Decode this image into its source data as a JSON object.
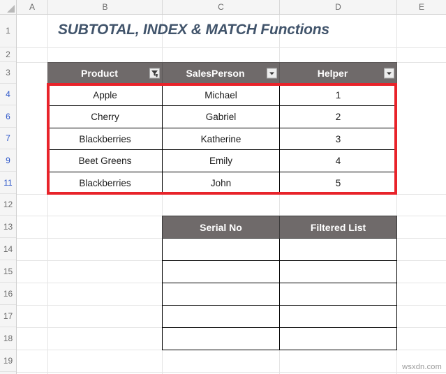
{
  "spreadsheet": {
    "title": "SUBTOTAL, INDEX & MATCH Functions",
    "watermark": "wsxdn.com",
    "column_headers": [
      "A",
      "B",
      "C",
      "D",
      "E"
    ],
    "row_headers": [
      {
        "label": "1",
        "filtered": false
      },
      {
        "label": "2",
        "filtered": false
      },
      {
        "label": "3",
        "filtered": false
      },
      {
        "label": "4",
        "filtered": true
      },
      {
        "label": "6",
        "filtered": true
      },
      {
        "label": "7",
        "filtered": true
      },
      {
        "label": "9",
        "filtered": true
      },
      {
        "label": "11",
        "filtered": true
      },
      {
        "label": "12",
        "filtered": false
      },
      {
        "label": "13",
        "filtered": false
      },
      {
        "label": "14",
        "filtered": false
      },
      {
        "label": "15",
        "filtered": false
      },
      {
        "label": "16",
        "filtered": false
      },
      {
        "label": "17",
        "filtered": false
      },
      {
        "label": "18",
        "filtered": false
      },
      {
        "label": "19",
        "filtered": false
      }
    ],
    "colors": {
      "header_fill": "#6f6a6a",
      "header_text": "#ffffff",
      "title_text": "#41546b",
      "highlight_border": "#e8232a",
      "filtered_row_header": "#2b55c9"
    }
  },
  "data_table": {
    "headers": [
      {
        "label": "Product",
        "filter_icon": "funnel-filter-applied-icon"
      },
      {
        "label": "SalesPerson",
        "filter_icon": "chevron-down-icon"
      },
      {
        "label": "Helper",
        "filter_icon": "chevron-down-icon"
      }
    ],
    "rows": [
      {
        "product": "Apple",
        "salesperson": "Michael",
        "helper": "1"
      },
      {
        "product": "Cherry",
        "salesperson": "Gabriel",
        "helper": "2"
      },
      {
        "product": "Blackberries",
        "salesperson": "Katherine",
        "helper": "3"
      },
      {
        "product": "Beet Greens",
        "salesperson": "Emily",
        "helper": "4"
      },
      {
        "product": "Blackberries",
        "salesperson": "John",
        "helper": "5"
      }
    ]
  },
  "output_table": {
    "headers": [
      {
        "label": "Serial No"
      },
      {
        "label": "Filtered List"
      }
    ],
    "rows": [
      {
        "serial_no": "",
        "filtered_list": ""
      },
      {
        "serial_no": "",
        "filtered_list": ""
      },
      {
        "serial_no": "",
        "filtered_list": ""
      },
      {
        "serial_no": "",
        "filtered_list": ""
      },
      {
        "serial_no": "",
        "filtered_list": ""
      }
    ]
  }
}
